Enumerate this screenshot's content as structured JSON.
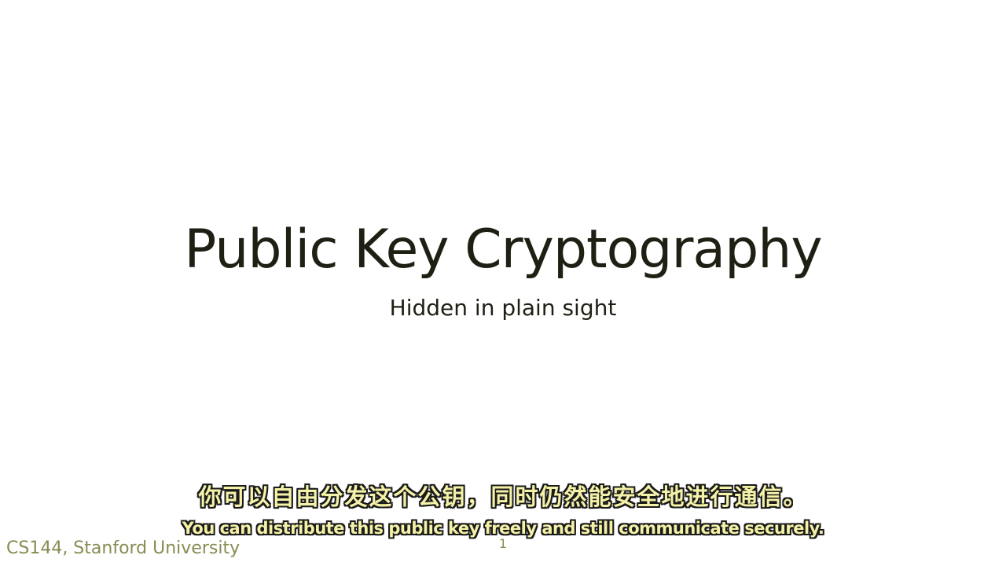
{
  "slide": {
    "title": "Public Key Cryptography",
    "subtitle": "Hidden in plain sight",
    "footer": "CS144, Stanford University",
    "page_number": "1"
  },
  "captions": {
    "chinese": "你可以自由分发这个公钥，同时仍然能安全地进行通信。",
    "english": "You can distribute this public key freely and still communicate securely."
  },
  "colors": {
    "background": "#ffffff",
    "title_text": "#1f1f14",
    "footer_text": "#8a8a52",
    "caption_fill": "#f4f1a8",
    "caption_outline": "#1b1b1b"
  }
}
